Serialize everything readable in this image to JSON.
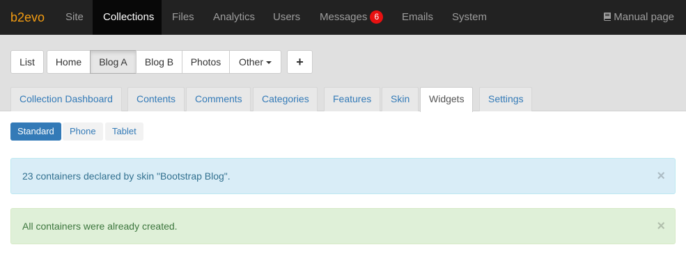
{
  "topnav": {
    "brand": "b2evo",
    "items": [
      {
        "label": "Site"
      },
      {
        "label": "Collections"
      },
      {
        "label": "Files"
      },
      {
        "label": "Analytics"
      },
      {
        "label": "Users"
      },
      {
        "label": "Messages",
        "badge": "6"
      },
      {
        "label": "Emails"
      },
      {
        "label": "System"
      }
    ],
    "active": "Collections",
    "manual": "Manual page"
  },
  "collection_buttons": {
    "list": "List",
    "items": [
      "Home",
      "Blog A",
      "Blog B",
      "Photos",
      "Other"
    ],
    "selected": "Blog A",
    "add": "+"
  },
  "tabs": {
    "items": [
      "Collection Dashboard",
      "Contents",
      "Comments",
      "Categories",
      "Features",
      "Skin",
      "Widgets",
      "Settings"
    ],
    "active": "Widgets"
  },
  "subtabs": {
    "items": [
      "Standard",
      "Phone",
      "Tablet"
    ],
    "active": "Standard"
  },
  "alerts": {
    "info": "23 containers declared by skin \"Bootstrap Blog\".",
    "success": "All containers were already created.",
    "close": "×"
  },
  "colors": {
    "navbar": "#222222",
    "brand": "#f39c12",
    "link": "#337ab7",
    "badge": "#e81111"
  }
}
